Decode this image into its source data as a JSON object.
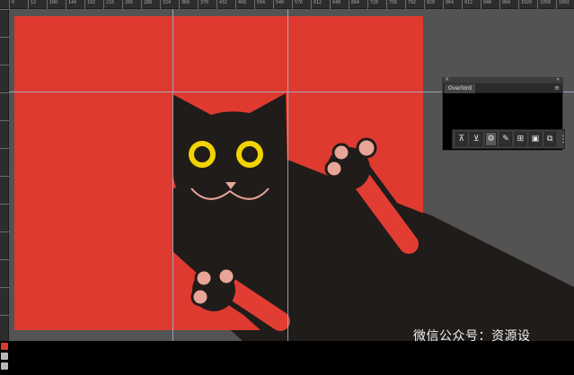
{
  "ruler": {
    "top_labels": [
      "0",
      "12",
      "100",
      "144",
      "192",
      "216",
      "266",
      "288",
      "324",
      "360",
      "378",
      "432",
      "468",
      "504",
      "540",
      "576",
      "612",
      "648",
      "684",
      "720",
      "756",
      "792",
      "828",
      "864",
      "912",
      "948",
      "984",
      "1020",
      "1056",
      "1092"
    ],
    "corner_label": "108"
  },
  "panel": {
    "tab_label": "Overlord",
    "close_glyph": "×",
    "grip_glyph": "«",
    "menu_glyph": "≡"
  },
  "toolbar": {
    "tools": [
      {
        "name": "align-top-icon",
        "glyph": "⊼"
      },
      {
        "name": "align-bottom-icon",
        "glyph": "⊻"
      },
      {
        "name": "settings-icon",
        "glyph": "⚙"
      },
      {
        "name": "edit-artboard-icon",
        "glyph": "✎"
      },
      {
        "name": "add-artboard-icon",
        "glyph": "⊞"
      },
      {
        "name": "export-icon",
        "glyph": "▣"
      },
      {
        "name": "layers-icon",
        "glyph": "⧉"
      }
    ],
    "more_glyph": "⋮"
  },
  "watermark": {
    "text": "微信公众号：资源设"
  },
  "colors": {
    "artboard": "#de3a30",
    "cat": "#201c1a",
    "eye_ring": "#f2d302",
    "paw_pad": "#e8a598",
    "arm": "#e23d33",
    "workspace": "#535353"
  }
}
